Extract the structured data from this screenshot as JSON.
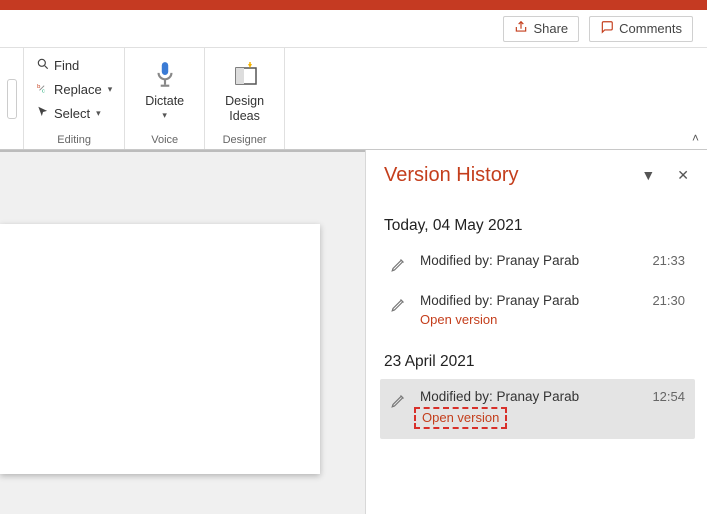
{
  "header": {
    "share_label": "Share",
    "comments_label": "Comments"
  },
  "ribbon": {
    "editing": {
      "find": "Find",
      "replace": "Replace",
      "select": "Select",
      "group_label": "Editing"
    },
    "voice": {
      "dictate": "Dictate",
      "group_label": "Voice"
    },
    "designer": {
      "design_ideas": "Design\nIdeas",
      "group_label": "Designer"
    }
  },
  "panel": {
    "title": "Version History",
    "groups": [
      {
        "date": "Today, 04 May 2021",
        "entries": [
          {
            "modified_by_label": "Modified by:",
            "modified_by": "Pranay Parab",
            "time": "21:33",
            "open_version": null,
            "selected": false,
            "highlight": false
          },
          {
            "modified_by_label": "Modified by:",
            "modified_by": "Pranay Parab",
            "time": "21:30",
            "open_version": "Open version",
            "selected": false,
            "highlight": false
          }
        ]
      },
      {
        "date": "23 April 2021",
        "entries": [
          {
            "modified_by_label": "Modified by:",
            "modified_by": "Pranay Parab",
            "time": "12:54",
            "open_version": "Open version",
            "selected": true,
            "highlight": true
          }
        ]
      }
    ]
  }
}
